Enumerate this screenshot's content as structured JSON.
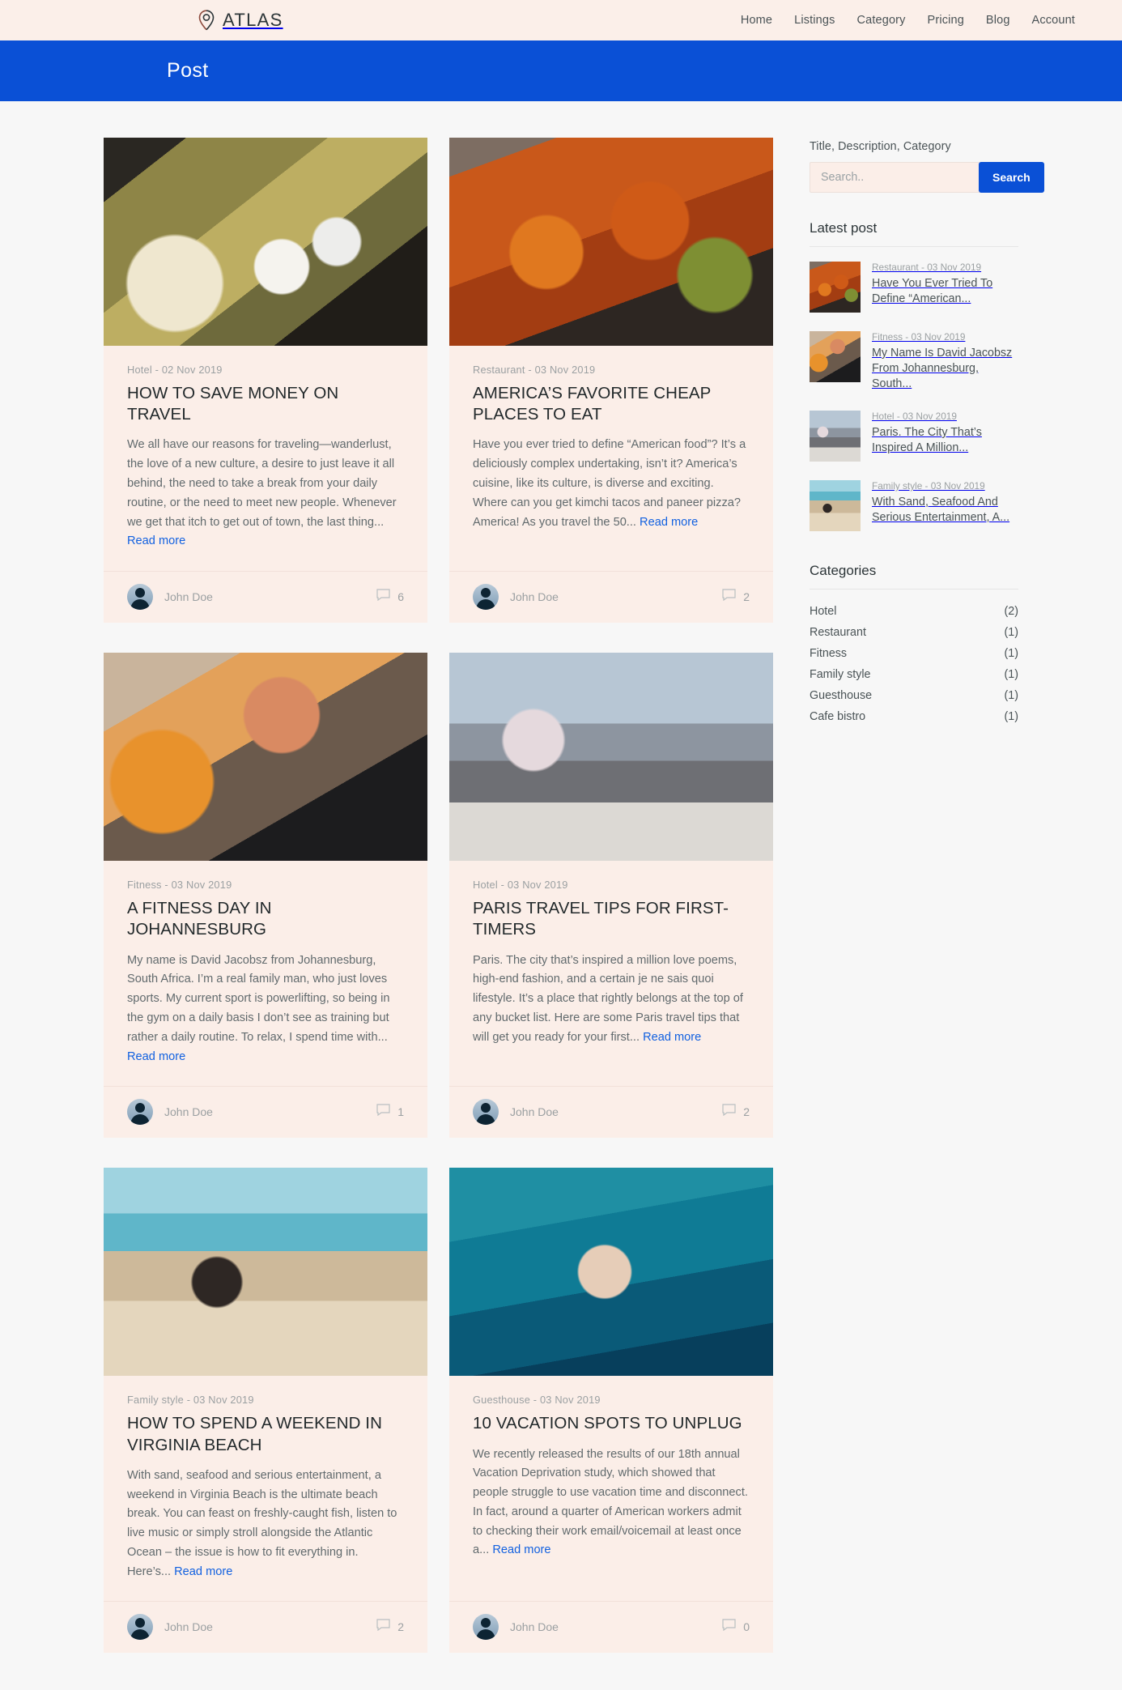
{
  "header": {
    "brand": "ATLAS",
    "brand_icon": "location-pin-icon",
    "nav": [
      {
        "label": "Home"
      },
      {
        "label": "Listings"
      },
      {
        "label": "Category"
      },
      {
        "label": "Pricing"
      },
      {
        "label": "Blog"
      },
      {
        "label": "Account"
      }
    ]
  },
  "banner": {
    "title": "Post"
  },
  "posts": [
    {
      "meta": "Hotel - 02 Nov 2019",
      "title": "HOW TO SAVE MONEY ON TRAVEL",
      "excerpt": "We all have our reasons for traveling—wanderlust, the love of a new culture, a desire to just leave it all behind, the need to take a break from your daily routine, or the need to meet new people. Whenever we get that itch to get out of town, the last thing...",
      "read_more": "Read more",
      "author": "John Doe",
      "comments": "6",
      "image": "passport-money-map-photo"
    },
    {
      "meta": "Restaurant - 03 Nov 2019",
      "title": "AMERICA’S FAVORITE CHEAP PLACES TO EAT",
      "excerpt": "Have you ever tried to define “American food”? It’s a deliciously complex undertaking, isn’t it? America’s cuisine, like its culture, is diverse and exciting. Where can you get kimchi tacos and paneer pizza? America! As you travel the 50...",
      "read_more": "Read more",
      "author": "John Doe",
      "comments": "2",
      "image": "chicken-wings-photo"
    },
    {
      "meta": "Fitness - 03 Nov 2019",
      "title": "A FITNESS DAY IN JOHANNESBURG",
      "excerpt": "My name is David Jacobsz from Johannesburg, South Africa. I’m a real family man, who just loves sports. My current sport is powerlifting, so being in the gym on a daily basis I don’t see as training but rather a daily routine. To relax, I spend time with...",
      "read_more": "Read more",
      "author": "John Doe",
      "comments": "1",
      "image": "gym-kettlebell-photo"
    },
    {
      "meta": "Hotel - 03 Nov 2019",
      "title": "PARIS TRAVEL TIPS FOR FIRST-TIMERS",
      "excerpt": "Paris. The city that’s inspired a million love poems, high-end fashion, and a certain je ne sais quoi lifestyle. It’s a place that rightly belongs at the top of any bucket list. Here are some Paris travel tips that will get you ready for your first...",
      "read_more": "Read more",
      "author": "John Doe",
      "comments": "2",
      "image": "eiffel-tower-photo"
    },
    {
      "meta": "Family style - 03 Nov 2019",
      "title": "HOW TO SPEND A WEEKEND IN VIRGINIA BEACH",
      "excerpt": "With sand, seafood and serious entertainment, a weekend in Virginia Beach is the ultimate beach break. You can feast on freshly-caught fish, listen to live music or simply stroll alongside the Atlantic Ocean – the issue is how to fit everything in. Here’s...",
      "read_more": "Read more",
      "author": "John Doe",
      "comments": "2",
      "image": "hammock-beach-photo"
    },
    {
      "meta": "Guesthouse - 03 Nov 2019",
      "title": "10 VACATION SPOTS TO UNPLUG",
      "excerpt": "We recently released the results of our 18th annual Vacation Deprivation study, which showed that people struggle to use vacation time and disconnect. In fact, around a quarter of American workers admit to checking their work email/voicemail at least once a...",
      "read_more": "Read more",
      "author": "John Doe",
      "comments": "0",
      "image": "snorkeling-photo"
    }
  ],
  "sidebar": {
    "search": {
      "label": "Title, Description, Category",
      "placeholder": "Search..",
      "value": "",
      "button": "Search"
    },
    "latest_heading": "Latest post",
    "latest": [
      {
        "meta": "Restaurant - 03 Nov 2019",
        "title": "Have You Ever Tried To Define “American...",
        "image": "chicken-wings-thumb"
      },
      {
        "meta": "Fitness - 03 Nov 2019",
        "title": "My Name Is David Jacobsz From Johannesburg, South...",
        "image": "gym-kettlebell-thumb"
      },
      {
        "meta": "Hotel - 03 Nov 2019",
        "title": "Paris. The City That’s Inspired A Million...",
        "image": "eiffel-tower-thumb"
      },
      {
        "meta": "Family style - 03 Nov 2019",
        "title": "With Sand, Seafood And Serious Entertainment, A...",
        "image": "hammock-beach-thumb"
      }
    ],
    "categories_heading": "Categories",
    "categories": [
      {
        "name": "Hotel",
        "count": "(2)"
      },
      {
        "name": "Restaurant",
        "count": "(1)"
      },
      {
        "name": "Fitness",
        "count": "(1)"
      },
      {
        "name": "Family style",
        "count": "(1)"
      },
      {
        "name": "Guesthouse",
        "count": "(1)"
      },
      {
        "name": "Cafe bistro",
        "count": "(1)"
      }
    ]
  },
  "colors": {
    "accent_blue": "#0a50d6",
    "card_bg": "#fbeee8",
    "page_bg": "#f7f7f7",
    "header_bg": "#fbefe9",
    "link_blue": "#1261e0"
  }
}
